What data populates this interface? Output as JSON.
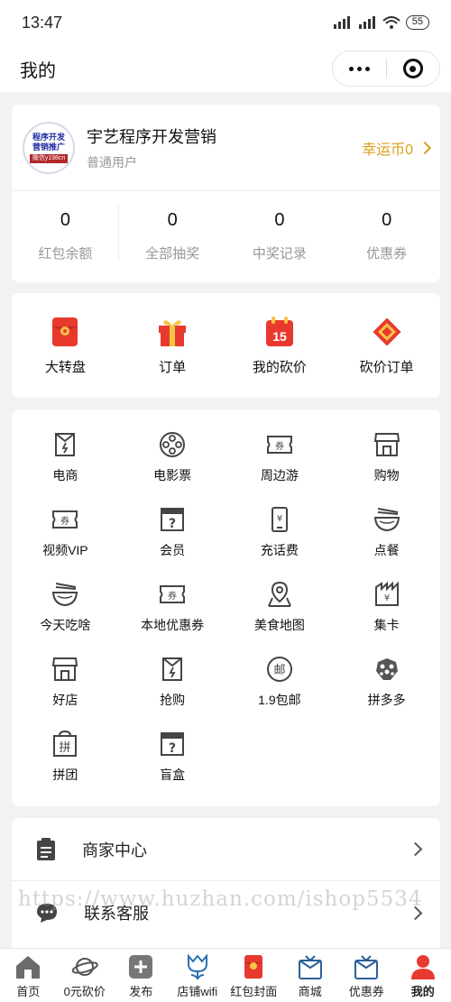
{
  "status_bar": {
    "time": "13:47",
    "battery": "55"
  },
  "header": {
    "title": "我的"
  },
  "profile": {
    "avatar_text_1": "程序开发",
    "avatar_text_2": "营销推广",
    "avatar_text_3": "微信y198cn",
    "name": "宇艺程序开发营销",
    "role": "普通用户",
    "coins_label": "幸运币0"
  },
  "stats": [
    {
      "value": "0",
      "label": "红包余额"
    },
    {
      "value": "0",
      "label": "全部抽奖"
    },
    {
      "value": "0",
      "label": "中奖记录"
    },
    {
      "value": "0",
      "label": "优惠券"
    }
  ],
  "quick_actions": [
    {
      "label": "大转盘",
      "icon": "red-envelope-icon"
    },
    {
      "label": "订单",
      "icon": "gift-icon"
    },
    {
      "label": "我的砍价",
      "icon": "calendar-15-icon"
    },
    {
      "label": "砍价订单",
      "icon": "fortune-icon"
    }
  ],
  "services": [
    {
      "label": "电商",
      "icon": "shopping-bag-icon"
    },
    {
      "label": "电影票",
      "icon": "film-reel-icon"
    },
    {
      "label": "周边游",
      "icon": "ticket-icon"
    },
    {
      "label": "购物",
      "icon": "storefront-icon"
    },
    {
      "label": "视频VIP",
      "icon": "coupon-icon"
    },
    {
      "label": "会员",
      "icon": "mystery-box-icon"
    },
    {
      "label": "充话费",
      "icon": "phone-yen-icon"
    },
    {
      "label": "点餐",
      "icon": "noodle-bowl-icon"
    },
    {
      "label": "今天吃啥",
      "icon": "noodle-bowl-icon"
    },
    {
      "label": "本地优惠券",
      "icon": "coupon-icon"
    },
    {
      "label": "美食地图",
      "icon": "map-pin-icon"
    },
    {
      "label": "集卡",
      "icon": "card-bag-icon"
    },
    {
      "label": "好店",
      "icon": "storefront-icon"
    },
    {
      "label": "抢购",
      "icon": "shopping-bag-icon"
    },
    {
      "label": "1.9包邮",
      "icon": "post-icon"
    },
    {
      "label": "拼多多",
      "icon": "pdd-icon"
    },
    {
      "label": "拼团",
      "icon": "group-buy-icon"
    },
    {
      "label": "盲盒",
      "icon": "mystery-box-icon"
    }
  ],
  "menu": [
    {
      "label": "商家中心",
      "icon": "clipboard-icon"
    },
    {
      "label": "联系客服",
      "icon": "chat-icon"
    }
  ],
  "watermark": "https://www.huzhan.com/ishop5534",
  "tabbar": [
    {
      "label": "首页",
      "icon": "home-icon"
    },
    {
      "label": "0元砍价",
      "icon": "planet-icon"
    },
    {
      "label": "发布",
      "icon": "plus-icon"
    },
    {
      "label": "店铺wifi",
      "icon": "tulip-icon"
    },
    {
      "label": "红包封面",
      "icon": "red-envelope-icon"
    },
    {
      "label": "商城",
      "icon": "gift-box-icon"
    },
    {
      "label": "优惠券",
      "icon": "gift-box-icon"
    },
    {
      "label": "我的",
      "icon": "person-icon"
    }
  ],
  "colors": {
    "accent_gold": "#d9a01a",
    "accent_red": "#e8392f",
    "background": "#f2f2f2"
  }
}
